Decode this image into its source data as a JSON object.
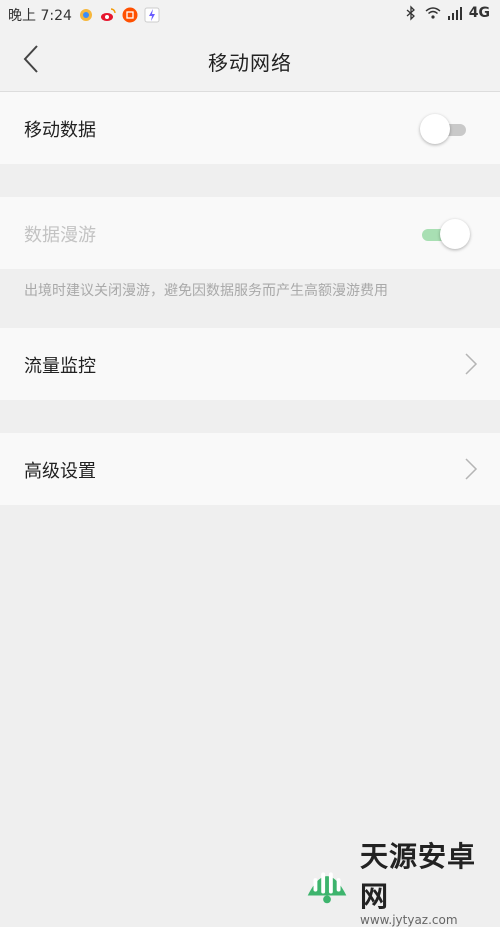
{
  "status_bar": {
    "time": "晚上 7:24",
    "network": "4G",
    "left_icons": [
      "app-icon",
      "weibo-icon",
      "taobao-icon",
      "flash-icon"
    ],
    "right_icons": [
      "bluetooth-icon",
      "wifi-icon",
      "signal-icon"
    ]
  },
  "header": {
    "title": "移动网络",
    "back_icon": "back-chevron-icon"
  },
  "settings": {
    "mobile_data": {
      "label": "移动数据",
      "enabled": false
    },
    "data_roaming": {
      "label": "数据漫游",
      "enabled": true,
      "disabled": true
    },
    "roaming_note": "出境时建议关闭漫游，避免因数据服务而产生高额漫游费用",
    "traffic_monitor": {
      "label": "流量监控"
    },
    "advanced": {
      "label": "高级设置"
    }
  },
  "watermark": {
    "title": "天源安卓网",
    "url": "www.jytyaz.com"
  },
  "colors": {
    "background": "#efefef",
    "row_background": "#f9f9f9",
    "toggle_on_track": "#a8dfb3",
    "watermark_green": "#3db46d"
  }
}
